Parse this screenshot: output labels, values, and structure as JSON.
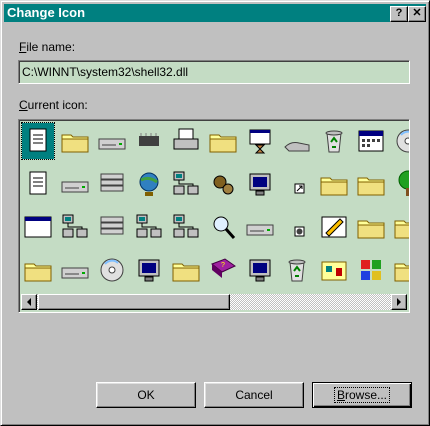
{
  "dialog": {
    "title": "Change Icon",
    "help_button": "?",
    "close_button": "✕"
  },
  "file": {
    "label": "File name:",
    "value": "C:\\WINNT\\system32\\shell32.dll"
  },
  "icons_label": "Current icon:",
  "icons": [
    [
      "doc-icon",
      "folder-icon",
      "drive-icon",
      "chip-icon",
      "printer-icon",
      "folder-open-icon",
      "hourglass-app-icon",
      "hand-icon",
      "recycle-bin-full-icon",
      "calendar-icon",
      "cd-audio-icon"
    ],
    [
      "text-doc-icon",
      "network-drive-icon",
      "server-icon",
      "globe-icon",
      "network-computers-icon",
      "gears-icon",
      "monitor-icon",
      "shortcut-arrow-icon",
      "folder-open-icon",
      "drive-folder-icon",
      "tree-icon"
    ],
    [
      "window-icon",
      "computer-network-icon",
      "server-disconnected-icon",
      "network-cable-icon",
      "network-icon",
      "find-icon",
      "drive-arrow-icon",
      "cdrom-small-icon",
      "shortcut-pen-icon",
      "fonts-folder-icon",
      "folder-computer-icon"
    ],
    [
      "folder-icon",
      "floppy-drive-icon",
      "cd-icon",
      "computer-icon",
      "folder-window-icon",
      "help-book-icon",
      "monitor-icon",
      "recycle-bin-icon",
      "control-panel-icon",
      "windows-logo-icon",
      "star-folder-icon"
    ]
  ],
  "scrollbar": {
    "left_arrow": "◀",
    "right_arrow": "▶",
    "position": 0
  },
  "buttons": {
    "ok": "OK",
    "cancel": "Cancel",
    "browse": "Browse..."
  }
}
